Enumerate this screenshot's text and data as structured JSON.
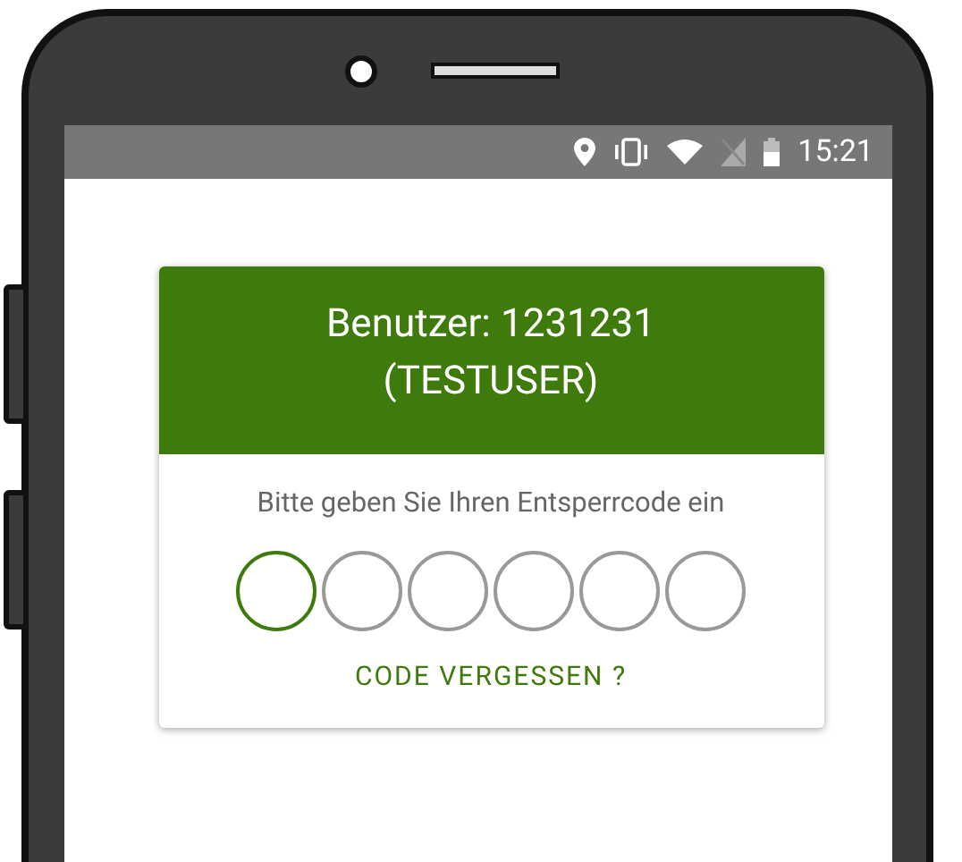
{
  "status_bar": {
    "time": "15:21"
  },
  "card": {
    "header": "Benutzer: 1231231\n(TESTUSER)",
    "prompt": "Bitte geben Sie Ihren Entsperrcode ein",
    "pin_digits": [
      {
        "selected": true
      },
      {
        "selected": false
      },
      {
        "selected": false
      },
      {
        "selected": false
      },
      {
        "selected": false
      },
      {
        "selected": false
      }
    ],
    "link": "CODE VERGESSEN ?"
  }
}
